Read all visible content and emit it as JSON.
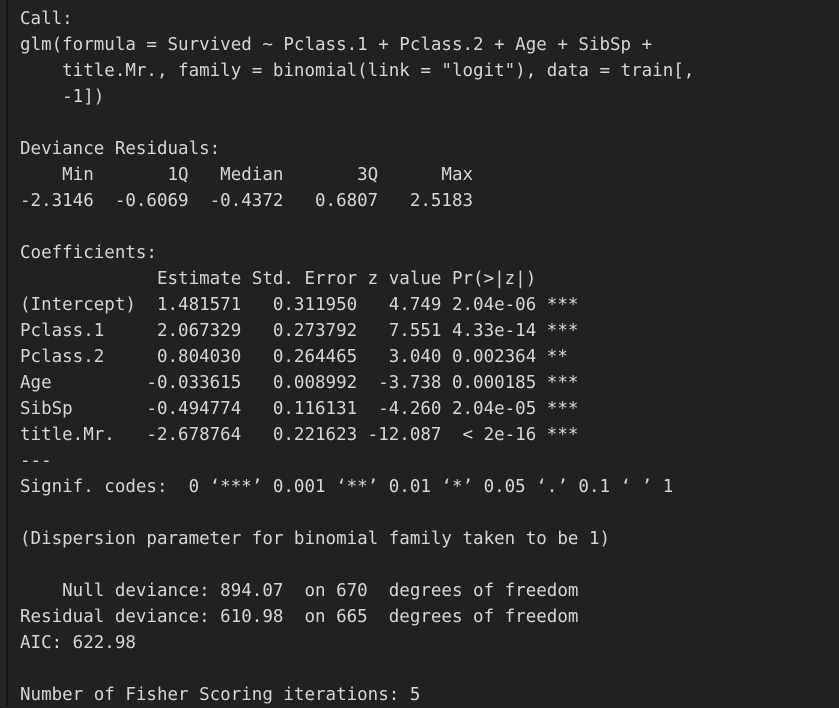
{
  "console": {
    "background_color": "#212121",
    "text_color": "#d6d6d6",
    "gutter_color": "#272727"
  },
  "output_lines": [
    "Call:",
    "glm(formula = Survived ~ Pclass.1 + Pclass.2 + Age + SibSp + ",
    "    title.Mr., family = binomial(link = \"logit\"), data = train[, ",
    "    -1])",
    "",
    "Deviance Residuals: ",
    "    Min       1Q   Median       3Q      Max  ",
    "-2.3146  -0.6069  -0.4372   0.6807   2.5183  ",
    "",
    "Coefficients:",
    "             Estimate Std. Error z value Pr(>|z|)    ",
    "(Intercept)  1.481571   0.311950   4.749 2.04e-06 ***",
    "Pclass.1     2.067329   0.273792   7.551 4.33e-14 ***",
    "Pclass.2     0.804030   0.264465   3.040 0.002364 ** ",
    "Age         -0.033615   0.008992  -3.738 0.000185 ***",
    "SibSp       -0.494774   0.116131  -4.260 2.04e-05 ***",
    "title.Mr.   -2.678764   0.221623 -12.087  < 2e-16 ***",
    "---",
    "Signif. codes:  0 ‘***’ 0.001 ‘**’ 0.01 ‘*’ 0.05 ‘.’ 0.1 ‘ ’ 1",
    "",
    "(Dispersion parameter for binomial family taken to be 1)",
    "",
    "    Null deviance: 894.07  on 670  degrees of freedom",
    "Residual deviance: 610.98  on 665  degrees of freedom",
    "AIC: 622.98",
    "",
    "Number of Fisher Scoring iterations: 5"
  ],
  "sections": {
    "call": {
      "header": "Call:",
      "formula": "glm(formula = Survived ~ Pclass.1 + Pclass.2 + Age + SibSp + title.Mr., family = binomial(link = \"logit\"), data = train[, -1])",
      "response": "Survived",
      "predictors": [
        "Pclass.1",
        "Pclass.2",
        "Age",
        "SibSp",
        "title.Mr."
      ],
      "family": "binomial",
      "link": "logit",
      "data": "train[, -1]"
    },
    "deviance_residuals": {
      "header": "Deviance Residuals:",
      "columns": [
        "Min",
        "1Q",
        "Median",
        "3Q",
        "Max"
      ],
      "values": [
        "-2.3146",
        "-0.6069",
        "-0.4372",
        "0.6807",
        "2.5183"
      ]
    },
    "coefficients": {
      "header": "Coefficients:",
      "columns": [
        "Estimate",
        "Std. Error",
        "z value",
        "Pr(>|z|)"
      ],
      "rows": [
        {
          "term": "(Intercept)",
          "estimate": "1.481571",
          "std_error": "0.311950",
          "z_value": "4.749",
          "p_value": "2.04e-06",
          "signif": "***"
        },
        {
          "term": "Pclass.1",
          "estimate": "2.067329",
          "std_error": "0.273792",
          "z_value": "7.551",
          "p_value": "4.33e-14",
          "signif": "***"
        },
        {
          "term": "Pclass.2",
          "estimate": "0.804030",
          "std_error": "0.264465",
          "z_value": "3.040",
          "p_value": "0.002364",
          "signif": "**"
        },
        {
          "term": "Age",
          "estimate": "-0.033615",
          "std_error": "0.008992",
          "z_value": "-3.738",
          "p_value": "0.000185",
          "signif": "***"
        },
        {
          "term": "SibSp",
          "estimate": "-0.494774",
          "std_error": "0.116131",
          "z_value": "-4.260",
          "p_value": "2.04e-05",
          "signif": "***"
        },
        {
          "term": "title.Mr.",
          "estimate": "-2.678764",
          "std_error": "0.221623",
          "z_value": "-12.087",
          "p_value": "< 2e-16",
          "signif": "***"
        }
      ],
      "separator": "---",
      "signif_codes": "Signif. codes:  0 ‘***’ 0.001 ‘**’ 0.01 ‘*’ 0.05 ‘.’ 0.1 ‘ ’ 1"
    },
    "dispersion": "(Dispersion parameter for binomial family taken to be 1)",
    "fit_statistics": {
      "null_deviance_label": "Null deviance:",
      "null_deviance": "894.07",
      "null_df": "670",
      "residual_deviance_label": "Residual deviance:",
      "residual_deviance": "610.98",
      "residual_df": "665",
      "df_suffix": "degrees of freedom",
      "aic_label": "AIC:",
      "aic": "622.98"
    },
    "iterations": {
      "label": "Number of Fisher Scoring iterations:",
      "value": "5",
      "full": "Number of Fisher Scoring iterations: 5"
    }
  }
}
